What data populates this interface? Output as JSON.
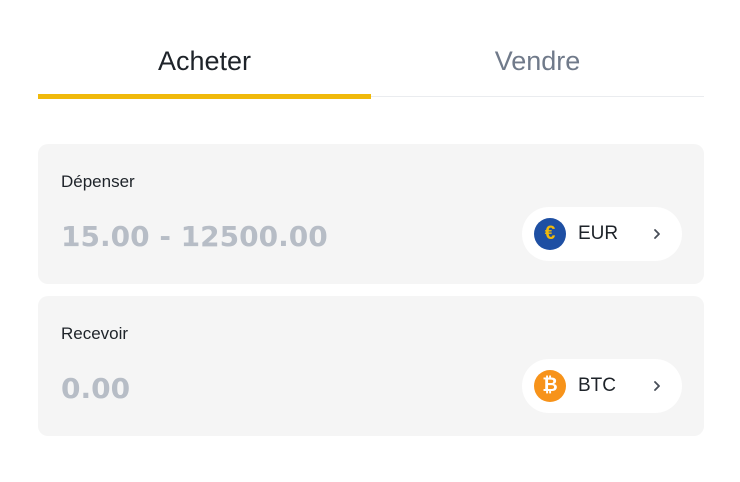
{
  "tabs": [
    {
      "label": "Acheter",
      "active": true
    },
    {
      "label": "Vendre",
      "active": false
    }
  ],
  "colors": {
    "accent": "#f0b90b",
    "text_primary": "#1e2329",
    "text_secondary": "#707a8a",
    "placeholder": "#b7bdc6",
    "field_bg": "#f5f5f5",
    "eur_icon_bg": "#1e4fa3",
    "eur_symbol": "#f0b90b",
    "btc_icon_bg": "#f7931a"
  },
  "spend": {
    "label": "Dépenser",
    "value": "",
    "placeholder": "15.00 - 12500.00",
    "asset": {
      "code": "EUR",
      "symbol": "€",
      "icon": "euro-coin-icon"
    }
  },
  "receive": {
    "label": "Recevoir",
    "value": "",
    "placeholder": "0.00",
    "asset": {
      "code": "BTC",
      "symbol": "₿",
      "icon": "bitcoin-coin-icon"
    }
  }
}
